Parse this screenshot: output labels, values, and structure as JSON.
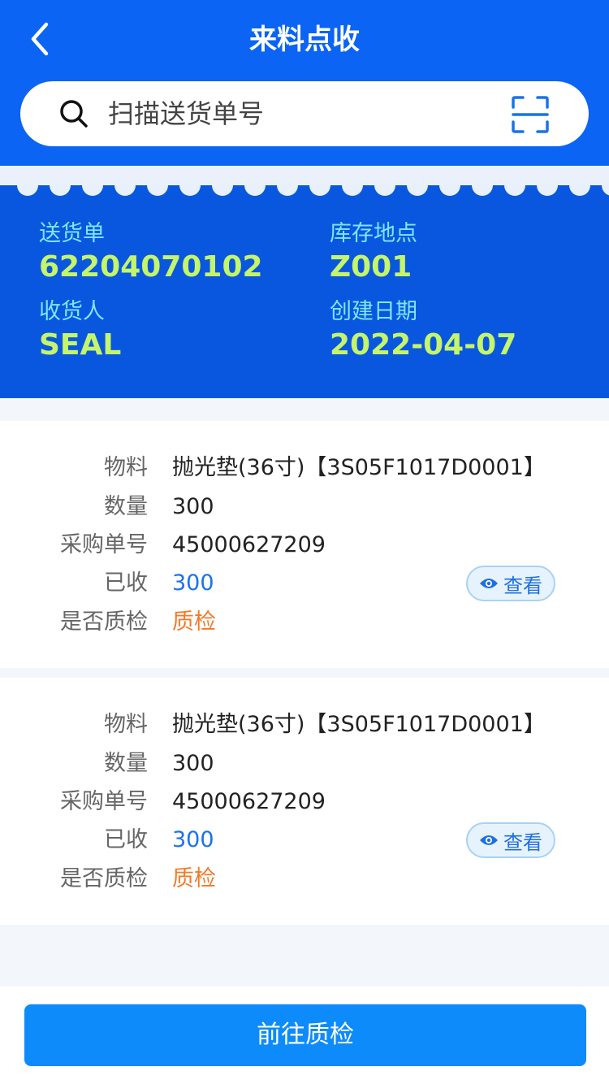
{
  "header": {
    "title": "来料点收",
    "back_icon": "chevron-left-icon"
  },
  "search": {
    "placeholder": "扫描送货单号",
    "search_icon": "search-icon",
    "scan_icon": "scan-icon"
  },
  "delivery": {
    "delivery_no_label": "送货单",
    "delivery_no": "62204070102",
    "location_label": "库存地点",
    "location": "Z001",
    "receiver_label": "收货人",
    "receiver": "SEAL",
    "date_label": "创建日期",
    "date": "2022-04-07"
  },
  "items": [
    {
      "material_label": "物料",
      "material": "抛光垫(36寸)【3S05F1017D0001】",
      "qty_label": "数量",
      "qty": "300",
      "po_label": "采购单号",
      "po": "45000627209",
      "received_label": "已收",
      "received": "300",
      "qc_label": "是否质检",
      "qc": "质检",
      "view_label": "查看"
    },
    {
      "material_label": "物料",
      "material": "抛光垫(36寸)【3S05F1017D0001】",
      "qty_label": "数量",
      "qty": "300",
      "po_label": "采购单号",
      "po": "45000627209",
      "received_label": "已收",
      "received": "300",
      "qc_label": "是否质检",
      "qc": "质检",
      "view_label": "查看"
    }
  ],
  "footer": {
    "button_label": "前往质检"
  },
  "colors": {
    "primary": "#0b64f3",
    "card": "#0a57df",
    "label_cyan": "#7fe6ff",
    "value_green": "#c4f56a",
    "blue_value": "#1a73e8",
    "orange_value": "#f07b2a",
    "button": "#0d8bfa"
  }
}
